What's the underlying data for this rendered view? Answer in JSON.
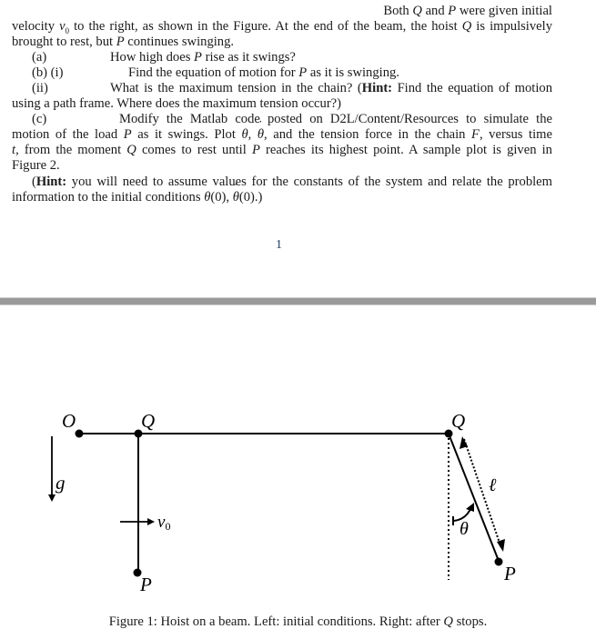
{
  "problem": {
    "line1": "Both Q and P were given initial",
    "line2": "velocity v0 to the right, as shown in the Figure. At the end of the beam, the hoist Q is impulsively",
    "line3": "brought to rest, but P continues swinging.",
    "parts": [
      {
        "label": "(a)",
        "text": "How high does P rise as it swings?"
      },
      {
        "label": "(b) (i)",
        "text": "Find the equation of motion for P as it is swinging."
      },
      {
        "label": "(ii)",
        "text": "What is the maximum tension in the chain? (Hint: Find the equation of motion using a path frame. Where does the maximum tension occur?)"
      },
      {
        "label": "(c)",
        "text": "Modify the Matlab code posted on D2L/Content/Resources to simulate the motion of the load P as it swings. Plot θ, θ̇, and the tension force in the chain F, versus time t, from the moment Q comes to rest until P reaches its highest point. A sample plot is given in Figure 2."
      }
    ],
    "hint_final": "(Hint: you will need to assume values for the constants of the system and relate the problem information to the initial conditions θ(0), θ̇(0).)"
  },
  "page_number": "1",
  "figure": {
    "labels": {
      "O": "O",
      "Q_left": "Q",
      "Q_right": "Q",
      "g": "g",
      "v0": "v",
      "v0_sub": "0",
      "P_left": "P",
      "P_right": "P",
      "ell": "ℓ",
      "theta": "θ"
    },
    "caption": "Figure 1: Hoist on a beam. Left: initial conditions. Right: after Q stops."
  }
}
